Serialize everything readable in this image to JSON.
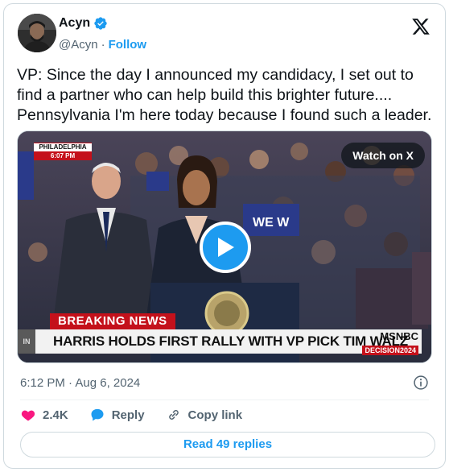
{
  "author": {
    "display_name": "Acyn",
    "handle": "@Acyn",
    "separator": "·",
    "follow_label": "Follow"
  },
  "tweet": {
    "text": "VP: Since the day I announced my candidacy, I set out to find a partner who can help build this brighter future.... Pennsylvania I'm here today because I found such a leader.",
    "timestamp": "6:12 PM · Aug 6, 2024"
  },
  "media": {
    "watch_label": "Watch on X",
    "location_badge": {
      "city": "PHILADELPHIA",
      "time": "6:07 PM"
    },
    "breaking_label": "BREAKING NEWS",
    "headline": "HARRIS HOLDS FIRST RALLY WITH VP PICK TIM WALZ",
    "network": "MSNBC",
    "network_tag": "DECISION2024",
    "side_text": "IN"
  },
  "actions": {
    "like_count": "2.4K",
    "reply_label": "Reply",
    "copy_link_label": "Copy link"
  },
  "footer": {
    "read_replies_label": "Read 49 replies"
  },
  "colors": {
    "accent": "#1d9bf0",
    "like": "#f91880",
    "muted": "#536471",
    "news_red": "#c4111b"
  }
}
